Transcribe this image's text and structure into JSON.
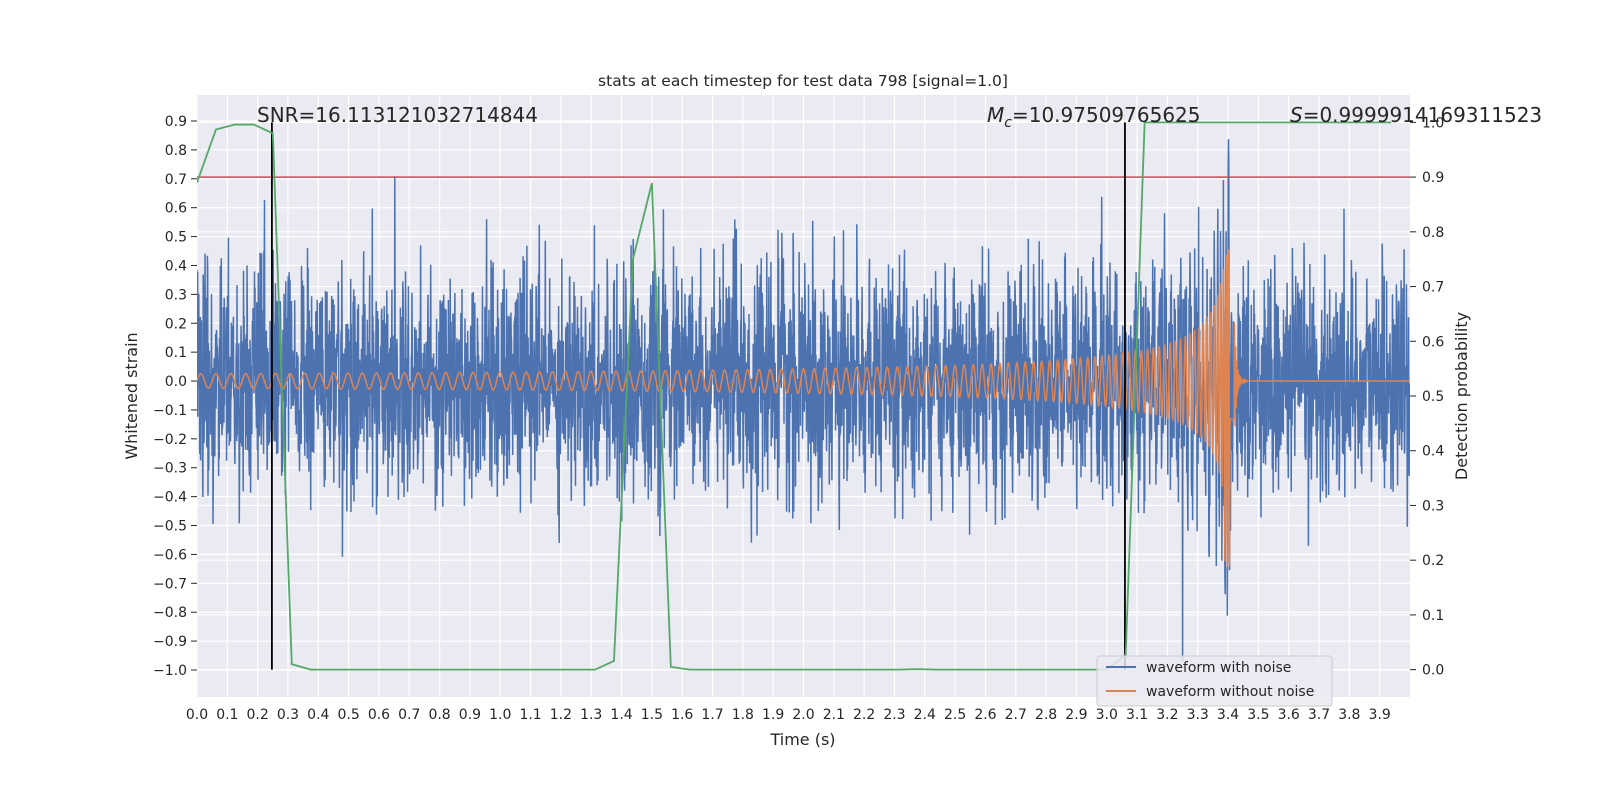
{
  "chart_data": {
    "type": "line",
    "title": "stats at each timestep for test data 798 [signal=1.0]",
    "xlabel": "Time (s)",
    "ylabel": "Whitened strain",
    "ylabel_right": "Detection probability",
    "xlim": [
      0.0,
      4.0
    ],
    "ylim": [
      -1.0935,
      0.99
    ],
    "ylim_right": [
      -0.05,
      1.05
    ],
    "grid": true,
    "legend_placement": "lower-right",
    "x_ticks": [
      "0.0",
      "0.1",
      "0.2",
      "0.3",
      "0.4",
      "0.5",
      "0.6",
      "0.7",
      "0.8",
      "0.9",
      "1.0",
      "1.1",
      "1.2",
      "1.3",
      "1.4",
      "1.5",
      "1.6",
      "1.7",
      "1.8",
      "1.9",
      "2.0",
      "2.1",
      "2.2",
      "2.3",
      "2.4",
      "2.5",
      "2.6",
      "2.7",
      "2.8",
      "2.9",
      "3.0",
      "3.1",
      "3.2",
      "3.3",
      "3.4",
      "3.5",
      "3.6",
      "3.7",
      "3.8",
      "3.9"
    ],
    "y_ticks": [
      "−1.0",
      "−0.9",
      "−0.8",
      "−0.7",
      "−0.6",
      "−0.5",
      "−0.4",
      "−0.3",
      "−0.2",
      "−0.1",
      "0.0",
      "0.1",
      "0.2",
      "0.3",
      "0.4",
      "0.5",
      "0.6",
      "0.7",
      "0.8",
      "0.9"
    ],
    "y_ticks_right": [
      "0.0",
      "0.1",
      "0.2",
      "0.3",
      "0.4",
      "0.5",
      "0.6",
      "0.7",
      "0.8",
      "0.9",
      "1.0"
    ],
    "annotations": {
      "snr": "SNR=16.113121032714844",
      "mc_symbol": "M",
      "mc_sub": "c",
      "mc_value": "=10.97509765625",
      "s_symbol": "S",
      "s_value": "=0.9999914169311523"
    },
    "series": [
      {
        "name": "waveform with noise",
        "color": "#4c72b0",
        "axis": "left",
        "noise_peak": 0.9,
        "noise_min": -0.97
      },
      {
        "name": "waveform without noise",
        "color": "#dd8452",
        "axis": "left",
        "initial_amplitude": 0.025,
        "peak_time": 3.42,
        "peak_amplitude": 0.46,
        "min_amplitude": -0.68
      }
    ],
    "detection_probability": {
      "color": "#55a868",
      "axis": "right",
      "x": [
        0.0,
        0.0625,
        0.125,
        0.1875,
        0.25,
        0.3125,
        0.375,
        0.4375,
        1.25,
        1.3125,
        1.375,
        1.4375,
        1.5,
        1.5625,
        1.625,
        2.3125,
        2.375,
        2.4375,
        3.0,
        3.0625,
        3.125,
        3.1875,
        3.9375
      ],
      "y": [
        0.89,
        0.987,
        0.996,
        0.996,
        0.98,
        0.01,
        0.0,
        0.0,
        0.0,
        0.0,
        0.016,
        0.75,
        0.889,
        0.005,
        0.0,
        0.0,
        0.001,
        0.0,
        0.0,
        0.027,
        1.0,
        1.0,
        1.0
      ]
    },
    "threshold": {
      "value": 0.9,
      "axis": "right",
      "color": "#c44e52"
    },
    "vertical_markers": {
      "x": [
        0.247,
        3.06
      ],
      "color": "#000000",
      "y_range_right": [
        0.0,
        1.0
      ]
    }
  }
}
